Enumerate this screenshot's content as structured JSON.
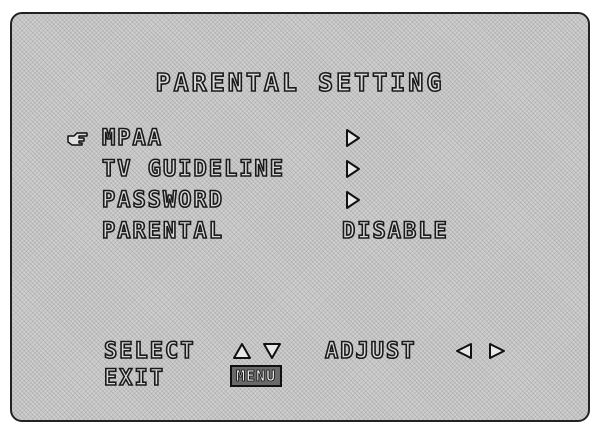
{
  "title": "PARENTAL SETTING",
  "menu": {
    "items": [
      {
        "label": "MPAA",
        "value": "",
        "has_arrow": true,
        "selected": true
      },
      {
        "label": "TV GUIDELINE",
        "value": "",
        "has_arrow": true,
        "selected": false
      },
      {
        "label": "PASSWORD",
        "value": "",
        "has_arrow": true,
        "selected": false
      },
      {
        "label": "PARENTAL",
        "value": "DISABLE",
        "has_arrow": false,
        "selected": false
      }
    ]
  },
  "footer": {
    "select_label": "SELECT",
    "adjust_label": "ADJUST",
    "exit_label": "EXIT",
    "menu_key_label": "MENU"
  },
  "icons": {
    "pointer": "pointing-hand-icon",
    "submenu_arrow": "triangle-right-outline-icon",
    "select_up": "triangle-up-outline-icon",
    "select_down": "triangle-down-outline-icon",
    "adjust_left": "triangle-left-outline-icon",
    "adjust_right": "triangle-right-outline-icon"
  }
}
